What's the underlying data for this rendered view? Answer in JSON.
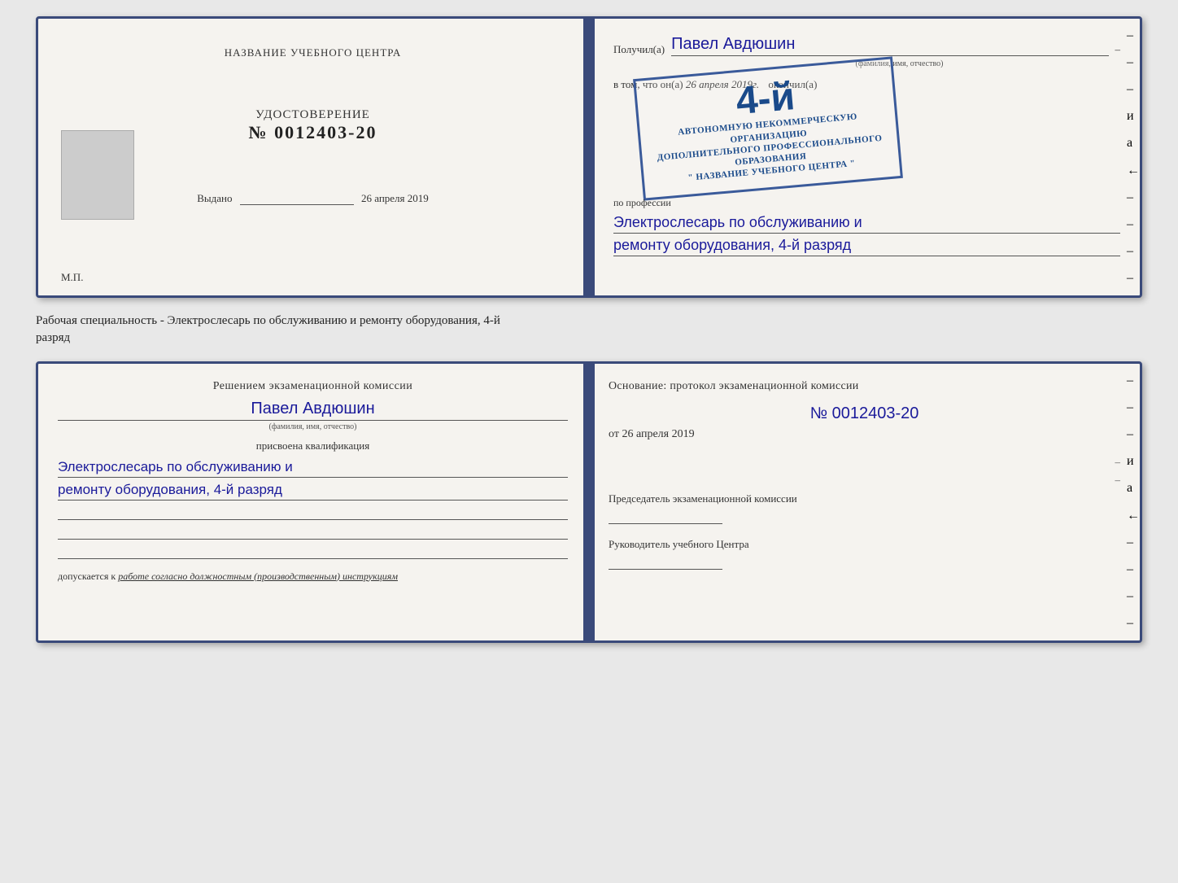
{
  "page": {
    "bg": "#e8e8e8"
  },
  "card1": {
    "left": {
      "heading": "НАЗВАНИЕ УЧЕБНОГО ЦЕНТРА",
      "cert_label": "УДОСТОВЕРЕНИЕ",
      "cert_number": "№ 0012403-20",
      "issued_label": "Выдано",
      "issued_date": "26 апреля 2019",
      "mp_label": "М.П."
    },
    "right": {
      "received_prefix": "Получил(a)",
      "recipient_name": "Павел Авдюшин",
      "fio_sub": "(фамилия, имя, отчество)",
      "vtom_prefix": "в том, что он(а)",
      "vtom_date": "26 апреля 2019г.",
      "okonchil": "окончил(а)",
      "stamp_number": "4-й",
      "stamp_line1": "АВТОНОМНУЮ НЕКОММЕРЧЕСКУЮ ОРГАНИЗАЦИЮ",
      "stamp_line2": "ДОПОЛНИТЕЛЬНОГО ПРОФЕССИОНАЛЬНОГО ОБРАЗОВАНИЯ",
      "stamp_line3": "\" НАЗВАНИЕ УЧЕБНОГО ЦЕНТРА \"",
      "profession_prefix": "по профессии",
      "profession_line1": "Электрослесарь по обслуживанию и",
      "profession_line2": "ремонту оборудования, 4-й разряд"
    }
  },
  "between": {
    "text_line1": "Рабочая специальность - Электрослесарь по обслуживанию и ремонту оборудования, 4-й",
    "text_line2": "разряд"
  },
  "card2": {
    "left": {
      "decision_heading": "Решением экзаменационной комиссии",
      "person_name": "Павел Авдюшин",
      "fio_sub": "(фамилия, имя, отчество)",
      "assigned_label": "присвоена квалификация",
      "qual_line1": "Электрослесарь по обслуживанию и",
      "qual_line2": "ремонту оборудования, 4-й разряд",
      "dopuskaetsya_prefix": "допускается к",
      "dopuskaetsya_value": "работе согласно должностным (производственным) инструкциям"
    },
    "right": {
      "osnov_heading": "Основание: протокол экзаменационной комиссии",
      "protocol_number": "№ 0012403-20",
      "from_prefix": "от",
      "from_date": "26 апреля 2019",
      "chairman_label": "Председатель экзаменационной комиссии",
      "rukov_label": "Руководитель учебного Центра"
    }
  },
  "side_ticks": {
    "right_labels": [
      "–",
      "–",
      "–",
      "и",
      "а",
      "←",
      "–",
      "–",
      "–",
      "–",
      "–"
    ]
  }
}
